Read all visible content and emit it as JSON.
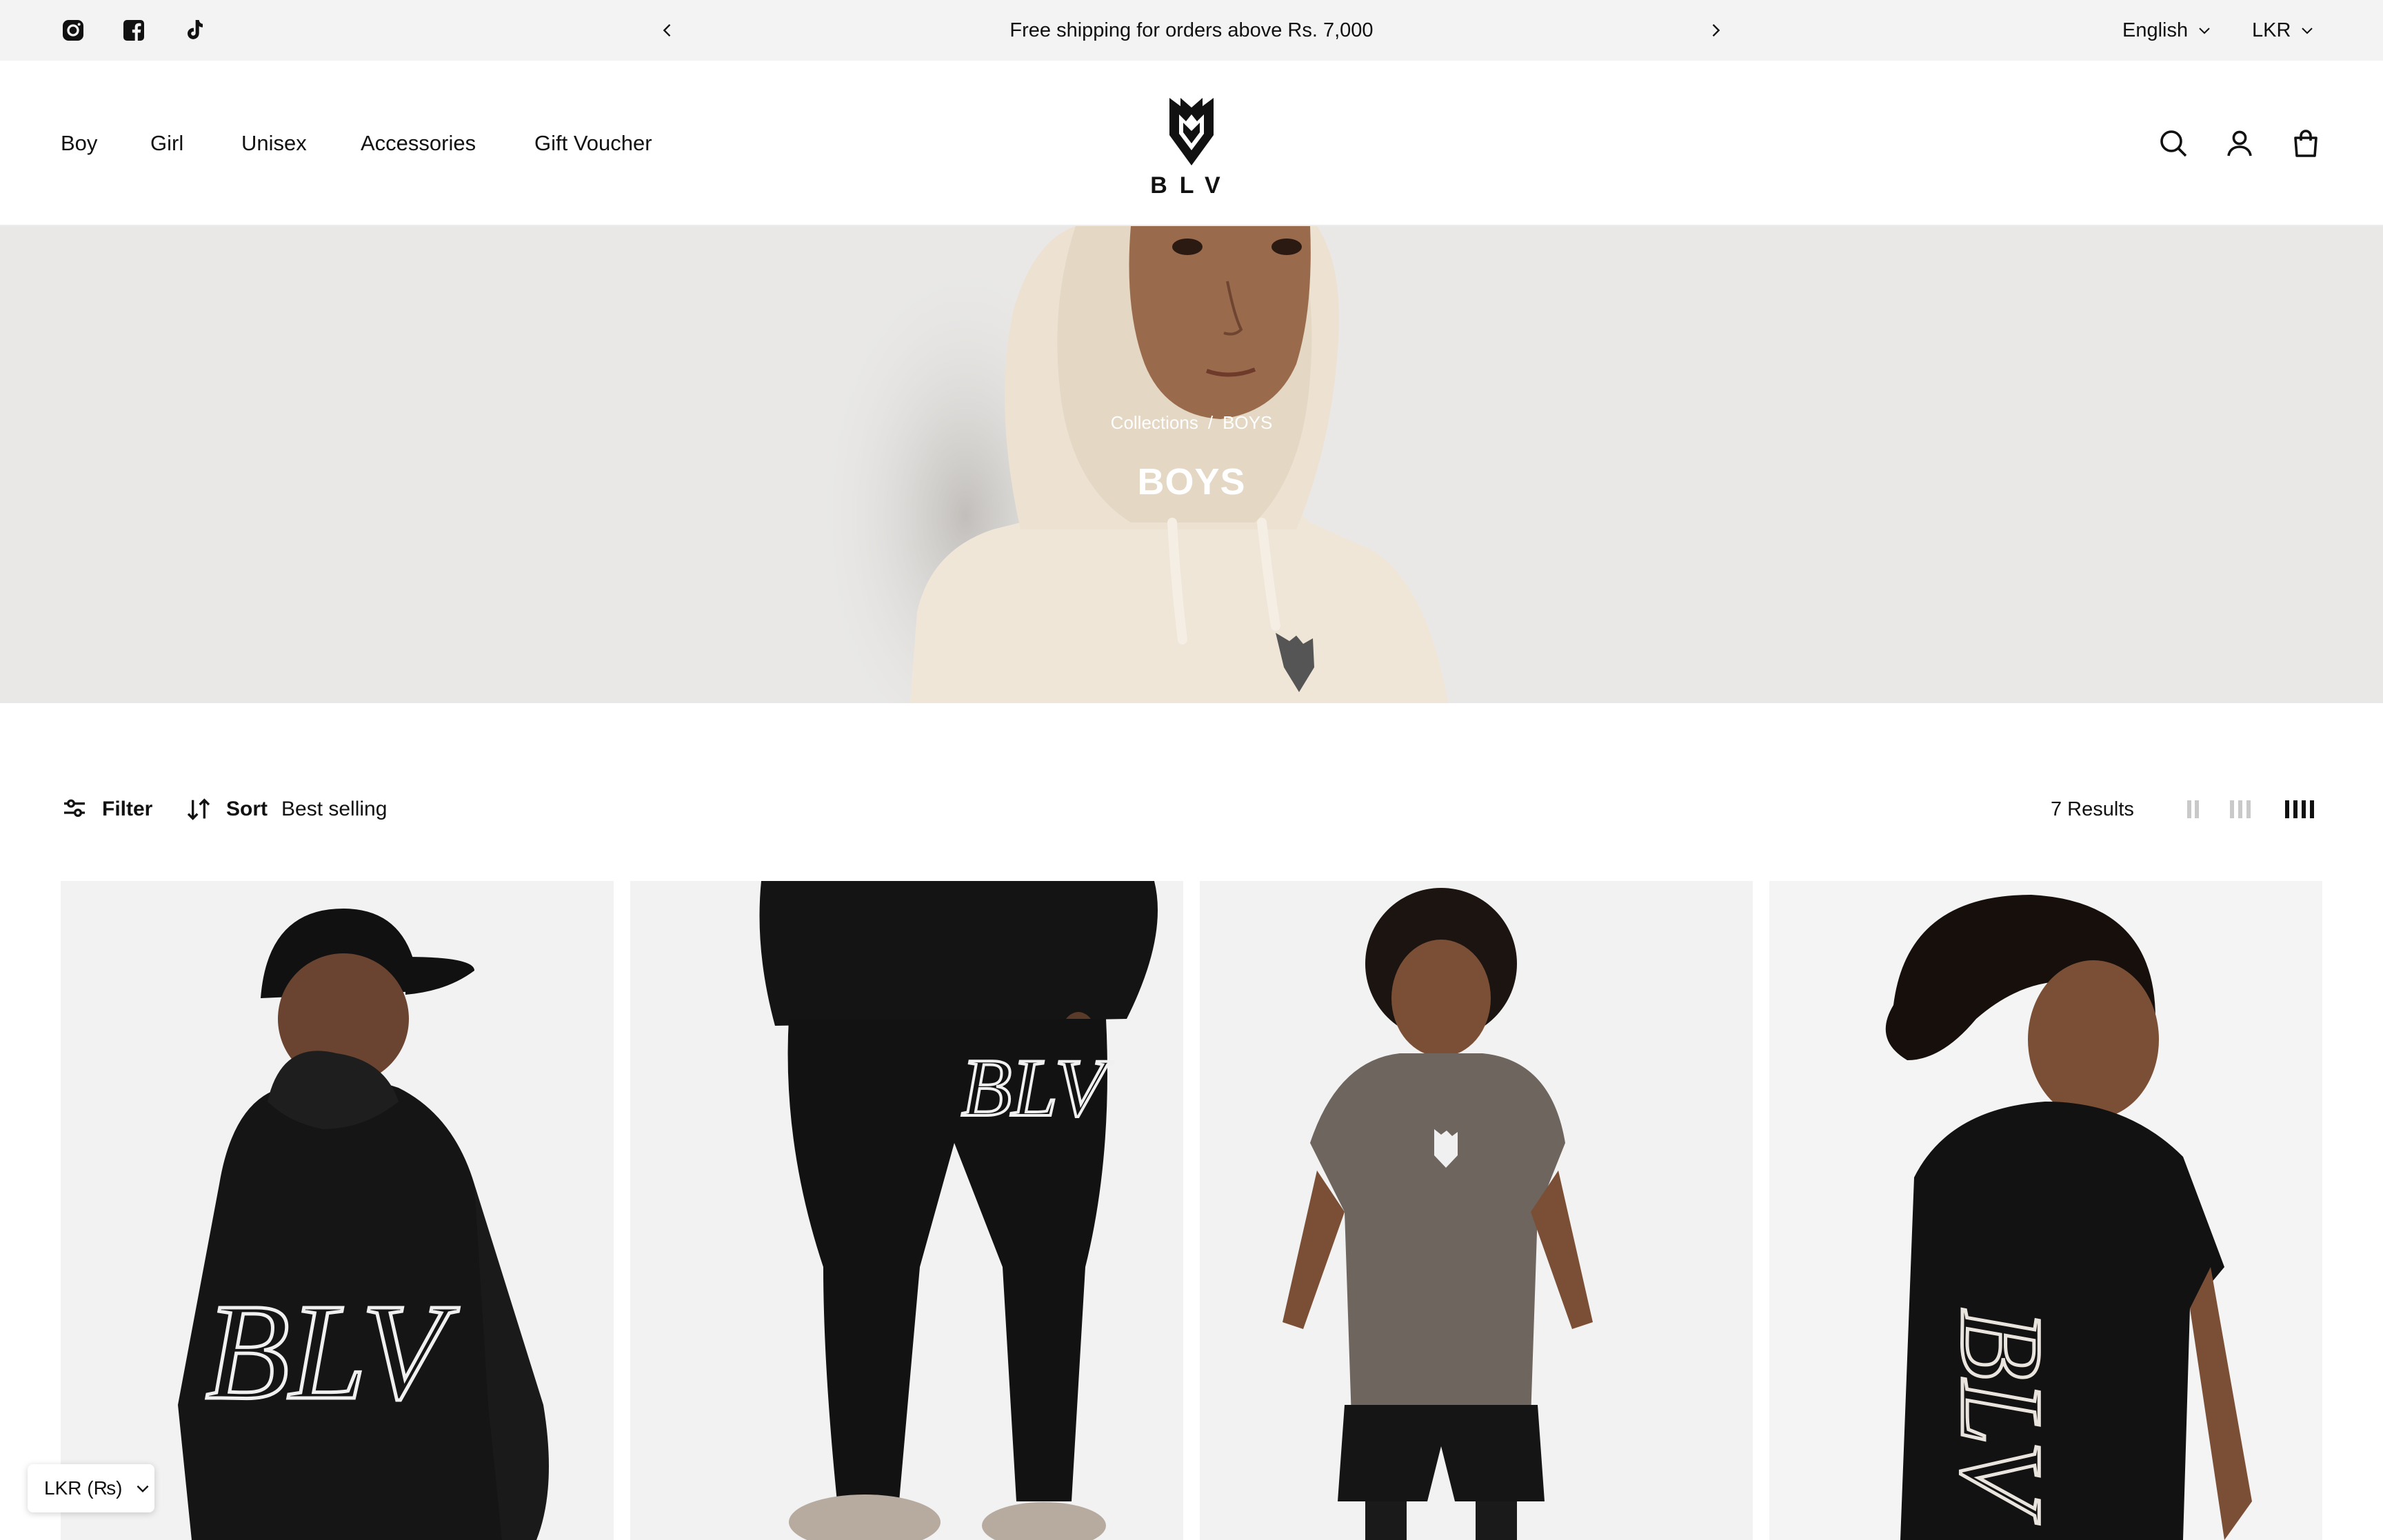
{
  "announcement": {
    "text": "Free shipping for orders above Rs. 7,000",
    "prev_icon": "chevron-left-icon",
    "next_icon": "chevron-right-icon"
  },
  "social": [
    "instagram-icon",
    "facebook-icon",
    "tiktok-icon"
  ],
  "localization": {
    "language": "English",
    "currency": "LKR"
  },
  "nav": {
    "items": [
      "Boy",
      "Girl",
      "Unisex",
      "Accessories",
      "Gift Voucher"
    ]
  },
  "brand": {
    "name": "BLV"
  },
  "header_icons": [
    "search-icon",
    "account-icon",
    "cart-icon"
  ],
  "hero": {
    "breadcrumb": [
      "Collections",
      "/",
      "BOYS"
    ],
    "title": "BOYS"
  },
  "toolbar": {
    "filter_label": "Filter",
    "sort_label": "Sort",
    "sort_value": "Best selling",
    "results": "7 Results"
  },
  "products": [
    {
      "image": "boy-black-hoodie-back-cap"
    },
    {
      "image": "black-joggers-blv-print"
    },
    {
      "image": "boy-brown-tee-black-shorts"
    },
    {
      "image": "girl-black-tee-back-print"
    }
  ],
  "currency_selector": {
    "label": "LKR (₨)"
  },
  "colors": {
    "topbar": "#f3f3f3",
    "hero_bg": "#e9e8e6",
    "text": "#111111",
    "card_bg": "#f2f2f2"
  }
}
